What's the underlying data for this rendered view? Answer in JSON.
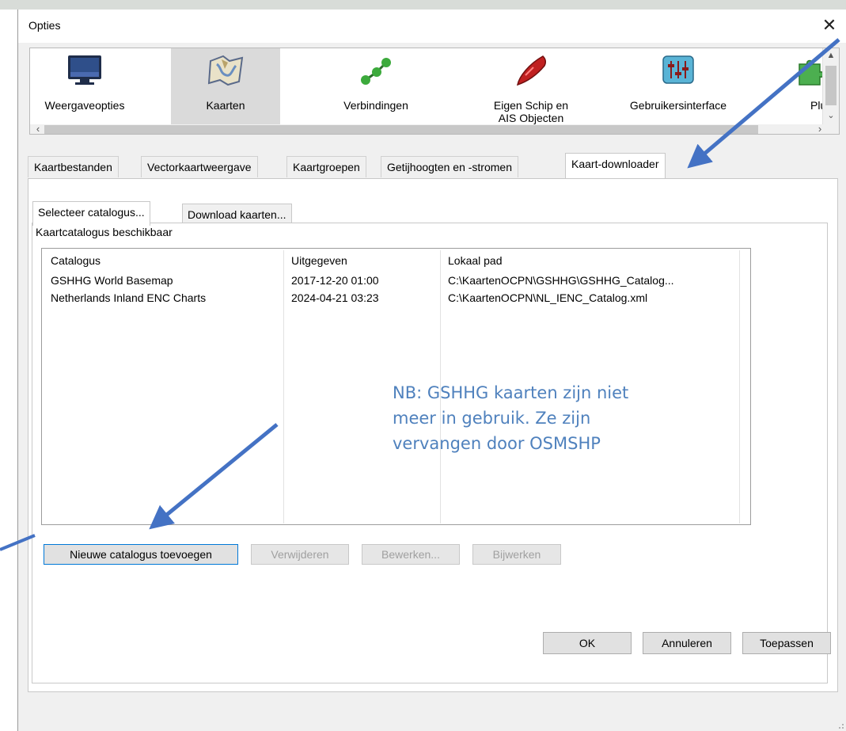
{
  "window": {
    "title": "Opties"
  },
  "toolbar": {
    "items": [
      {
        "label": "Weergaveopties"
      },
      {
        "label": "Kaarten"
      },
      {
        "label": "Verbindingen"
      },
      {
        "label": "Eigen Schip en AIS Objecten"
      },
      {
        "label": "Gebruikersinterface"
      },
      {
        "label": "Plugi"
      }
    ],
    "selected": "Kaarten"
  },
  "tabs": [
    {
      "label": "Kaartbestanden"
    },
    {
      "label": "Vectorkaartweergave"
    },
    {
      "label": "Kaartgroepen"
    },
    {
      "label": "Getijhoogten en -stromen"
    },
    {
      "label": "Kaart-downloader"
    }
  ],
  "active_tab": "Kaart-downloader",
  "subtabs": [
    {
      "label": "Selecteer catalogus..."
    },
    {
      "label": "Download kaarten..."
    }
  ],
  "catalog": {
    "group_label": "Kaartcatalogus beschikbaar",
    "columns": [
      "Catalogus",
      "Uitgegeven",
      "Lokaal pad"
    ],
    "rows": [
      [
        "GSHHG World Basemap",
        "2017-12-20 01:00",
        "C:\\KaartenOCPN\\GSHHG\\GSHHG_Catalog..."
      ],
      [
        "Netherlands Inland ENC Charts",
        "2024-04-21 03:23",
        "C:\\KaartenOCPN\\NL_IENC_Catalog.xml"
      ]
    ]
  },
  "buttons": {
    "add": "Nieuwe catalogus toevoegen",
    "remove": "Verwijderen",
    "edit": "Bewerken...",
    "update": "Bijwerken"
  },
  "dialog_buttons": {
    "ok": "OK",
    "cancel": "Annuleren",
    "apply": "Toepassen"
  },
  "annotation": {
    "note_lines": [
      "NB: GSHHG kaarten zijn niet",
      "meer in gebruik. Ze zijn",
      "vervangen door OSMSHP"
    ],
    "color": "#4f81bd"
  },
  "icons": {
    "close": "close-icon",
    "display": "monitor-icon",
    "charts": "chart-map-icon",
    "connections": "connection-nodes-icon",
    "ship": "ship-icon",
    "ui": "sliders-icon",
    "plugins": "puzzle-icon"
  }
}
